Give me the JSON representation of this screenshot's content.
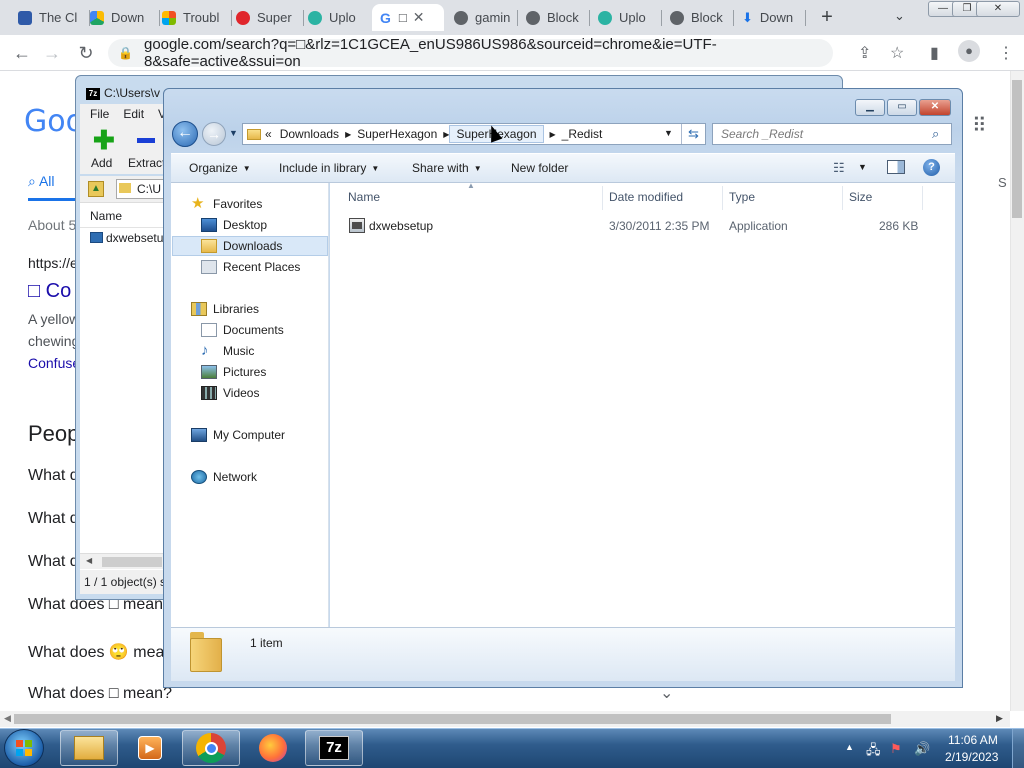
{
  "browser": {
    "tabs": [
      {
        "label": "The Cl",
        "color": "#2f5aa8"
      },
      {
        "label": "Down",
        "color": "#1fa463"
      },
      {
        "label": "Troubl",
        "color": "#f25022"
      },
      {
        "label": "Super",
        "color": "#e0262c"
      },
      {
        "label": "Uplo",
        "color": "#2bb3a3"
      },
      {
        "label": "G",
        "active": true
      },
      {
        "label": "gamin",
        "color": "#5f6368"
      },
      {
        "label": "Block",
        "color": "#5f6368"
      },
      {
        "label": "Uplo",
        "color": "#2bb3a3"
      },
      {
        "label": "Block",
        "color": "#5f6368"
      },
      {
        "label": "Down",
        "color": "#1a73e8"
      }
    ],
    "active_tab_glyph": "□",
    "new_tab_icon": "+",
    "url": "google.com/search?q=□&rlz=1C1GCEA_enUS986US986&sourceid=chrome&ie=UTF-8&safe=active&ssui=on"
  },
  "google": {
    "logo": "Goo",
    "tab_all": "All",
    "about": "About 5",
    "result_url": "https://e",
    "result_title": "□ Co",
    "snippet_line1": "A yellow",
    "snippet_line2": "chewing",
    "snippet_link": "Confuse",
    "people_heading": "Peop",
    "q1": "What d",
    "q2": "What d",
    "q3": "What d",
    "q4": "What does □ mean",
    "q5": "What does 🙄 mea",
    "q6": "What does □ mean?",
    "right_letter": "S",
    "expand_icon": "chevron-down"
  },
  "zip": {
    "title": "C:\\Users\\v",
    "badge": "7z",
    "menu": [
      "File",
      "Edit",
      "V"
    ],
    "add_label": "Add",
    "extract_label": "Extract",
    "address": "C:\\U",
    "col_name": "Name",
    "file": "dxwebsetu",
    "status": "1 / 1 object(s) s"
  },
  "explorer": {
    "breadcrumb": [
      "Downloads",
      "SuperHexagon",
      "SuperHexagon",
      "_Redist"
    ],
    "search_placeholder": "Search _Redist",
    "commands": [
      "Organize",
      "Include in library",
      "Share with",
      "New folder"
    ],
    "nav": {
      "favorites": "Favorites",
      "desktop": "Desktop",
      "downloads": "Downloads",
      "recent": "Recent Places",
      "libraries": "Libraries",
      "documents": "Documents",
      "music": "Music",
      "pictures": "Pictures",
      "videos": "Videos",
      "computer": "My Computer",
      "network": "Network"
    },
    "columns": {
      "name": "Name",
      "date": "Date modified",
      "type": "Type",
      "size": "Size"
    },
    "file": {
      "name": "dxwebsetup",
      "date": "3/30/2011 2:35 PM",
      "type": "Application",
      "size": "286 KB"
    },
    "item_count": "1 item"
  },
  "taskbar": {
    "apps": [
      "explorer-icon",
      "media-player-icon",
      "chrome-icon",
      "firefox-icon",
      "7zip-icon"
    ],
    "zip_label": "7z",
    "time": "11:06 AM",
    "date": "2/19/2023"
  },
  "colors": {
    "chrome_tab_strip": "#dee1e6",
    "explorer_frame": "#c9dbef",
    "taskbar": "#2f5c8c",
    "google_link": "#1a0dab"
  }
}
